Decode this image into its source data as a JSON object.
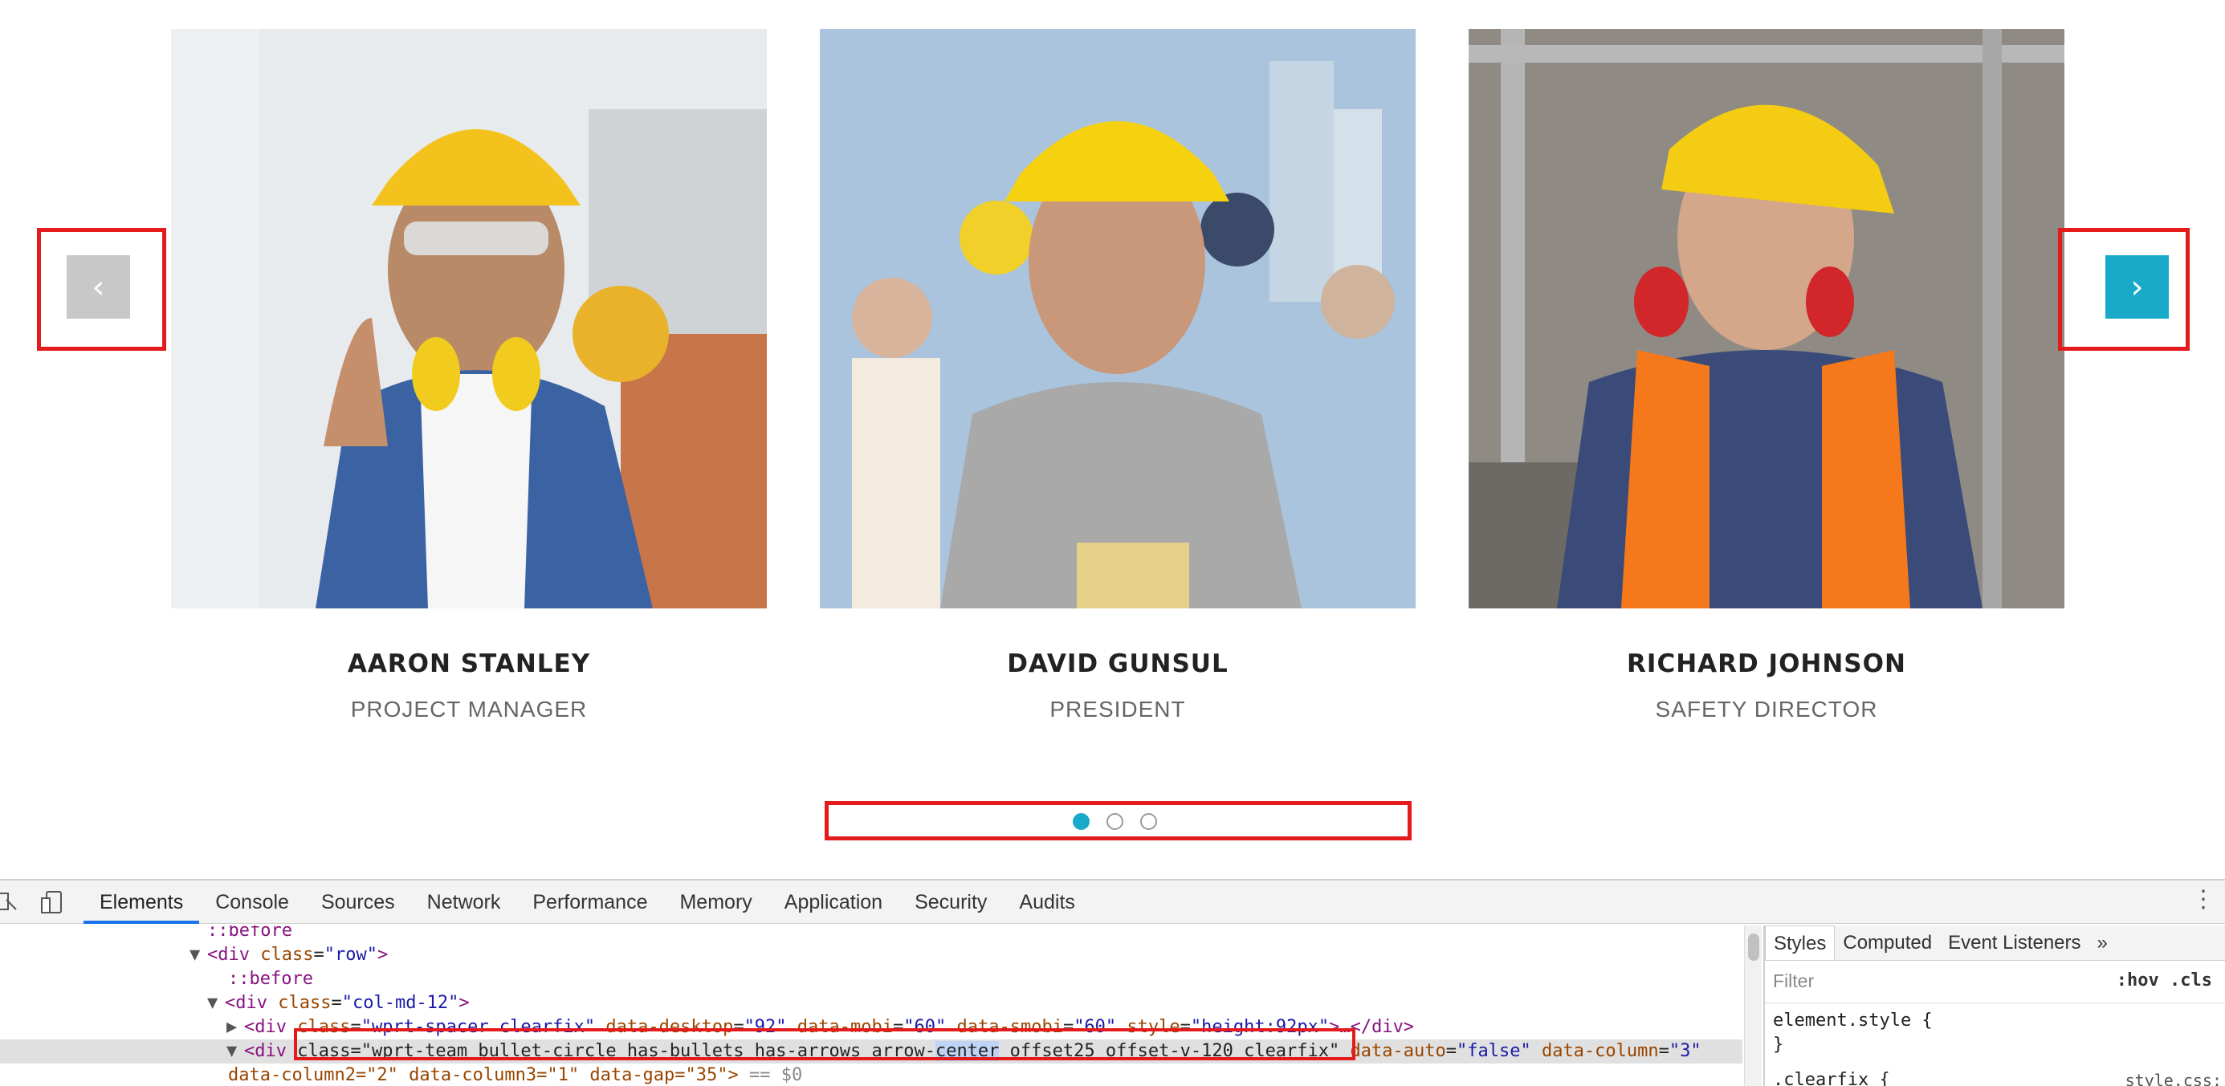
{
  "team": [
    {
      "name": "AARON STANLEY",
      "role": "PROJECT MANAGER"
    },
    {
      "name": "DAVID GUNSUL",
      "role": "PRESIDENT"
    },
    {
      "name": "RICHARD JOHNSON",
      "role": "SAFETY DIRECTOR"
    }
  ],
  "carousel": {
    "prev_icon": "‹",
    "next_icon": "›",
    "pages": 3,
    "active_page": 1
  },
  "colors": {
    "accent": "#19a9c9",
    "highlight": "#e41b1b"
  },
  "devtools": {
    "tabs": [
      "Elements",
      "Console",
      "Sources",
      "Network",
      "Performance",
      "Memory",
      "Application",
      "Security",
      "Audits"
    ],
    "active_tab": "Elements",
    "dom": {
      "l0_pseudo": "::before",
      "l1_tag_open": "<div ",
      "l1_attr": "class",
      "l1_val": "\"row\"",
      "l1_tag_close": ">",
      "l2_pseudo": "::before",
      "l3_tag_open": "<div ",
      "l3_attr": "class",
      "l3_val": "\"col-md-12\"",
      "l3_tag_close": ">",
      "l4_tag_open": "<div ",
      "l4_a1": "class",
      "l4_v1": "\"wprt-spacer clearfix\"",
      "l4_a2": " data-desktop",
      "l4_v2": "\"92\"",
      "l4_a3": " data-mobi",
      "l4_v3": "\"60\"",
      "l4_a4": " data-smobi",
      "l4_v4": "\"60\"",
      "l4_a5": " style",
      "l4_v5": "\"height:92px\"",
      "l4_tag_close": ">…</div>",
      "l5_tag_open": "<div ",
      "l5_class_prefix": "class=\"wprt-team bullet-circle has-bullets  has-arrows arrow-",
      "l5_class_hl": "center",
      "l5_class_suffix": " offset25 offset-v-120 clearfix\"",
      "l5_a2": " data-auto",
      "l5_v2": "\"false\"",
      "l5_a3": " data-column",
      "l5_v3": "\"3\"",
      "l6_text": "data-column2=\"2\" data-column3=\"1\" data-gap=\"35\">",
      "l6_eq": " == $0"
    },
    "styles": {
      "tabs": [
        "Styles",
        "Computed",
        "Event Listeners",
        "»"
      ],
      "filter_placeholder": "Filter",
      "hov_cls": ":hov  .cls",
      "rule1_selector": "element.style {",
      "rule1_close": "}",
      "rule2_selector": ".clearfix {",
      "rule2_source": "style.css:"
    }
  }
}
